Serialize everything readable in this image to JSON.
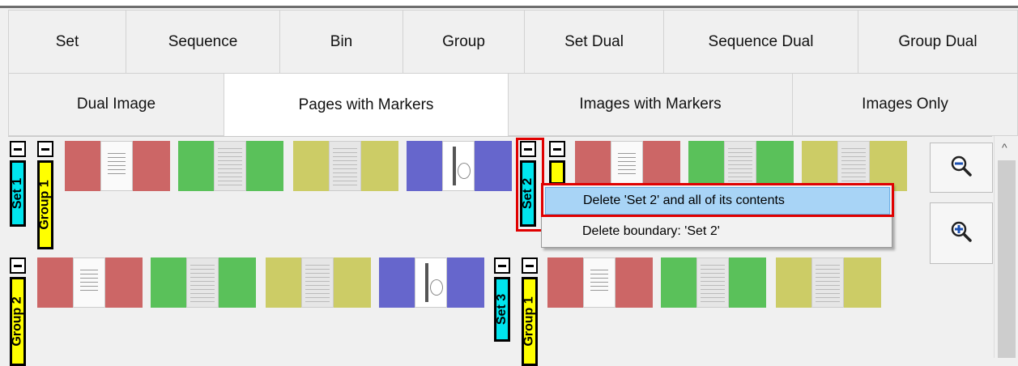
{
  "tabs_row1": [
    "Set",
    "Sequence",
    "Bin",
    "Group",
    "Set Dual",
    "Sequence Dual",
    "Group Dual"
  ],
  "tabs_row2": [
    "Dual Image",
    "Pages with Markers",
    "Images with Markers",
    "Images Only"
  ],
  "active_tab": "Pages with Markers",
  "colors": {
    "red_page": "#cc6666",
    "green_page": "#5ac15a",
    "yellow_page": "#cccc66",
    "blue_page": "#6666cc",
    "set_marker": "#00e5ee",
    "group_marker": "#ffff00",
    "menu_highlight": "#a8d4f6",
    "outline": "#e00000"
  },
  "markers": {
    "set1": "Set 1",
    "group1_top": "Group 1",
    "set2": "Set 2",
    "group2": "Group 2",
    "set3": "Set 3",
    "group1_bottom": "Group 1"
  },
  "context_menu": {
    "delete_set": "Delete 'Set 2' and all of its contents",
    "delete_boundary": "Delete boundary: 'Set 2'"
  },
  "zoom": {
    "zoom_out_icon": "magnifier-minus-icon",
    "zoom_in_icon": "magnifier-plus-icon"
  },
  "scroll": {
    "arrow": "^"
  }
}
